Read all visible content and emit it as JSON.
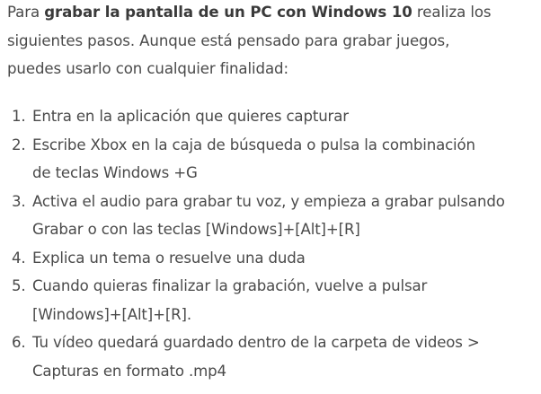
{
  "intro": {
    "before": "Para ",
    "bold_1": "grabar la pantalla de un PC con Windows 10",
    "line_1_after": " realiza los",
    "line_2": "siguientes pasos. Aunque está pensado para grabar juegos,",
    "line_3": "puedes usarlo con cualquier finalidad:"
  },
  "steps": [
    {
      "num": "1.",
      "lines": [
        "Entra en la aplicación que quieres capturar"
      ]
    },
    {
      "num": "2.",
      "lines": [
        "Escribe Xbox en la caja de búsqueda o pulsa la combinación",
        "de teclas Windows +G"
      ]
    },
    {
      "num": "3.",
      "lines": [
        "Activa el audio para grabar tu voz, y empieza a grabar pulsando",
        "Grabar o con las teclas [Windows]+[Alt]+[R]"
      ]
    },
    {
      "num": "4.",
      "lines": [
        "Explica un tema o resuelve una duda"
      ]
    },
    {
      "num": "5.",
      "lines": [
        "Cuando quieras finalizar la grabación, vuelve a pulsar",
        "[Windows]+[Alt]+[R]."
      ]
    },
    {
      "num": "6.",
      "lines": [
        "Tu vídeo quedará guardado dentro de la carpeta de videos >",
        "Capturas en formato .mp4"
      ]
    }
  ]
}
